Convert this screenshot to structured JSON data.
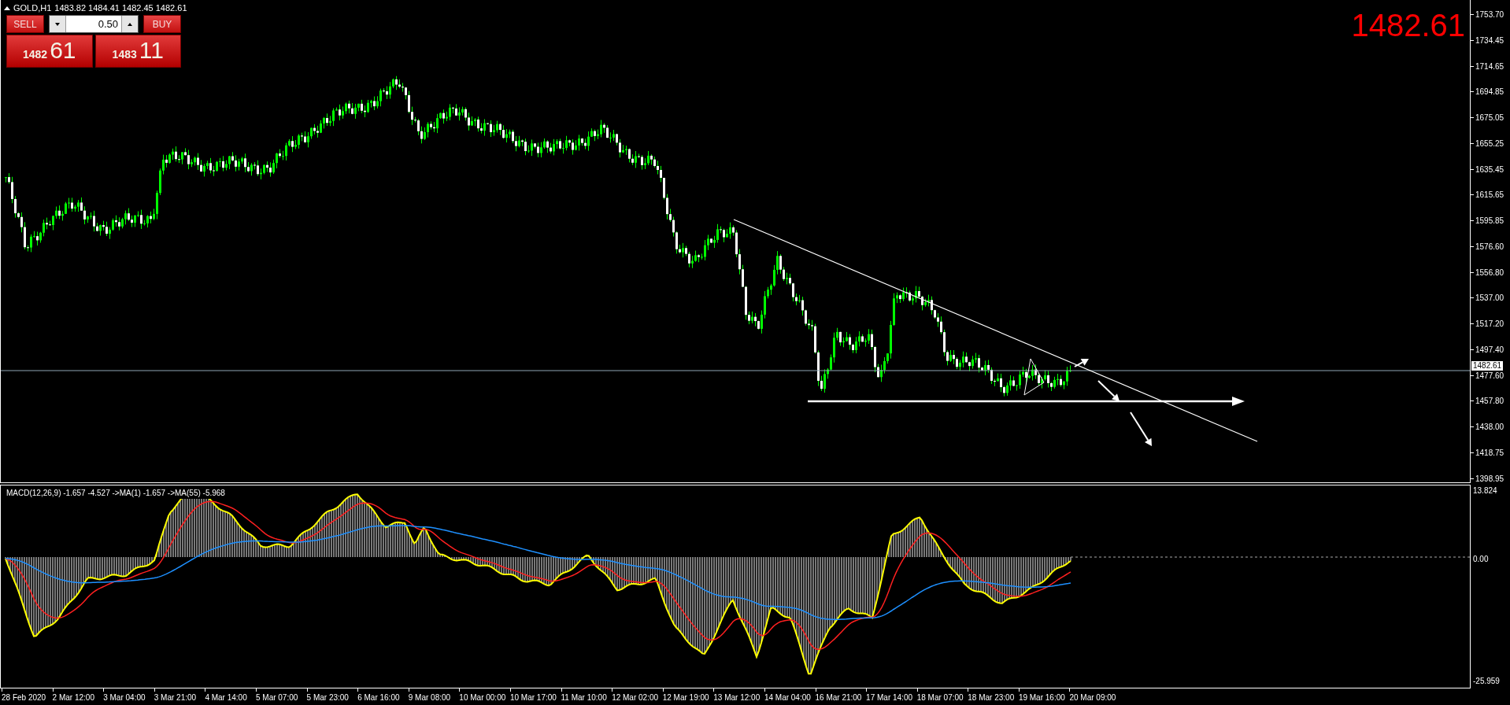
{
  "chart": {
    "symbol": "GOLD,H1",
    "quotes": [
      "1483.82",
      "1484.41",
      "1482.45",
      "1482.61"
    ],
    "last_price": "1482.61",
    "price_label": "1482.61",
    "price_axis": [
      "1753.70",
      "1734.45",
      "1714.65",
      "1694.85",
      "1675.05",
      "1655.25",
      "1635.45",
      "1615.65",
      "1595.85",
      "1576.60",
      "1556.80",
      "1537.00",
      "1517.20",
      "1497.40",
      "1477.60",
      "1457.80",
      "1438.00",
      "1418.75",
      "1398.95"
    ],
    "time_axis": [
      "28 Feb 2020",
      "2 Mar 12:00",
      "3 Mar 04:00",
      "3 Mar 21:00",
      "4 Mar 14:00",
      "5 Mar 07:00",
      "5 Mar 23:00",
      "6 Mar 16:00",
      "9 Mar 08:00",
      "10 Mar 00:00",
      "10 Mar 17:00",
      "11 Mar 10:00",
      "12 Mar 02:00",
      "12 Mar 19:00",
      "13 Mar 12:00",
      "14 Mar 04:00",
      "16 Mar 21:00",
      "17 Mar 14:00",
      "18 Mar 07:00",
      "18 Mar 23:00",
      "19 Mar 16:00",
      "20 Mar 09:00"
    ]
  },
  "trade_panel": {
    "sell": {
      "label": "SELL",
      "price_main": "1482",
      "price_pips": "61"
    },
    "lot": "0.50",
    "buy": {
      "label": "BUY",
      "price_main": "1483",
      "price_pips": "11"
    }
  },
  "macd": {
    "label": "MACD(12,26,9) -1.657 -4.527 ->MA(1) -1.657 ->MA(55) -5.968",
    "scale": [
      "13.824",
      "0.00",
      "-25.959"
    ]
  }
}
